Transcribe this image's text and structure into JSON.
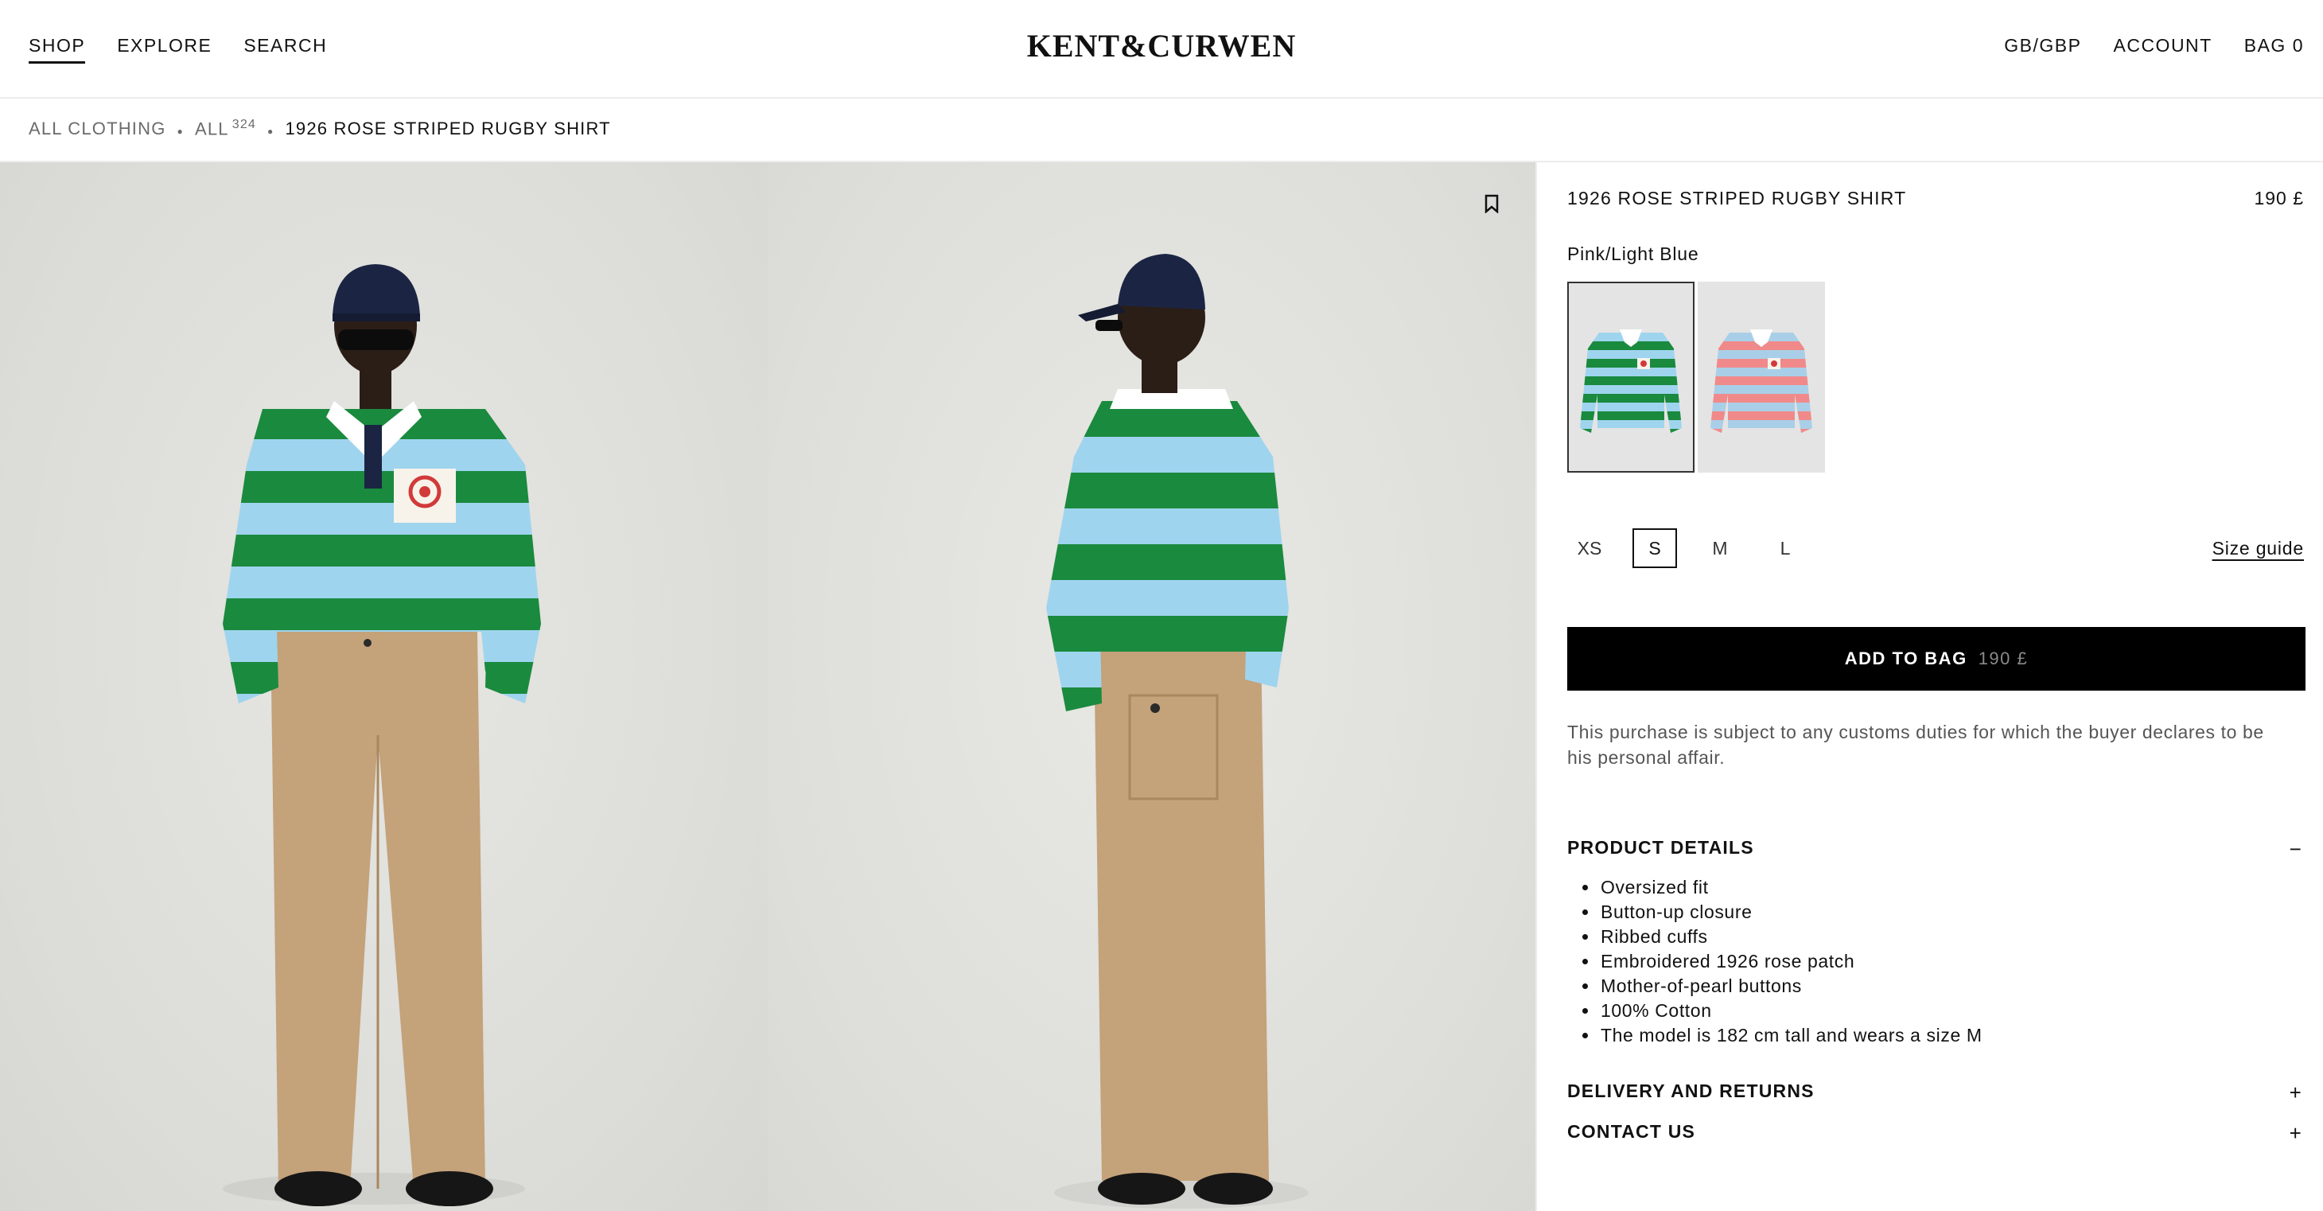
{
  "header": {
    "nav_left": [
      "SHOP",
      "EXPLORE",
      "SEARCH"
    ],
    "logo": "KENT&CURWEN",
    "nav_right": [
      "GB/GBP",
      "ACCOUNT",
      "BAG 0"
    ]
  },
  "breadcrumb": {
    "items": [
      "ALL CLOTHING",
      "ALL"
    ],
    "count": "324",
    "current": "1926 ROSE STRIPED RUGBY SHIRT"
  },
  "product": {
    "title": "1926 ROSE STRIPED RUGBY SHIRT",
    "price": "190 £",
    "color": "Pink/Light Blue",
    "swatches": [
      {
        "name": "green-light-blue",
        "stripe_a": "#1a8a3e",
        "stripe_b": "#9fd4ee"
      },
      {
        "name": "pink-light-blue",
        "stripe_a": "#f08a8a",
        "stripe_b": "#a9cfe8"
      }
    ],
    "sizes": [
      "XS",
      "S",
      "M",
      "L"
    ],
    "selected_size": "S",
    "size_guide": "Size guide",
    "add_to_bag": "ADD TO BAG",
    "add_to_bag_price": "190 £",
    "customs_note": "This purchase is subject to any customs duties for which the buyer declares to be his personal affair."
  },
  "sections": {
    "details_title": "PRODUCT DETAILS",
    "details_toggle": "−",
    "details": [
      "Oversized fit",
      "Button-up closure",
      "Ribbed cuffs",
      "Embroidered 1926 rose patch",
      "Mother-of-pearl buttons",
      "100% Cotton",
      "The model is 182 cm tall and wears a size M"
    ],
    "delivery_title": "DELIVERY AND RETURNS",
    "delivery_toggle": "+",
    "contact_title": "CONTACT US",
    "contact_toggle": "+"
  },
  "colors": {
    "green": "#1a8a3e",
    "light_blue": "#9fd4ee",
    "khaki": "#c4a27a",
    "navy": "#1b2543"
  }
}
